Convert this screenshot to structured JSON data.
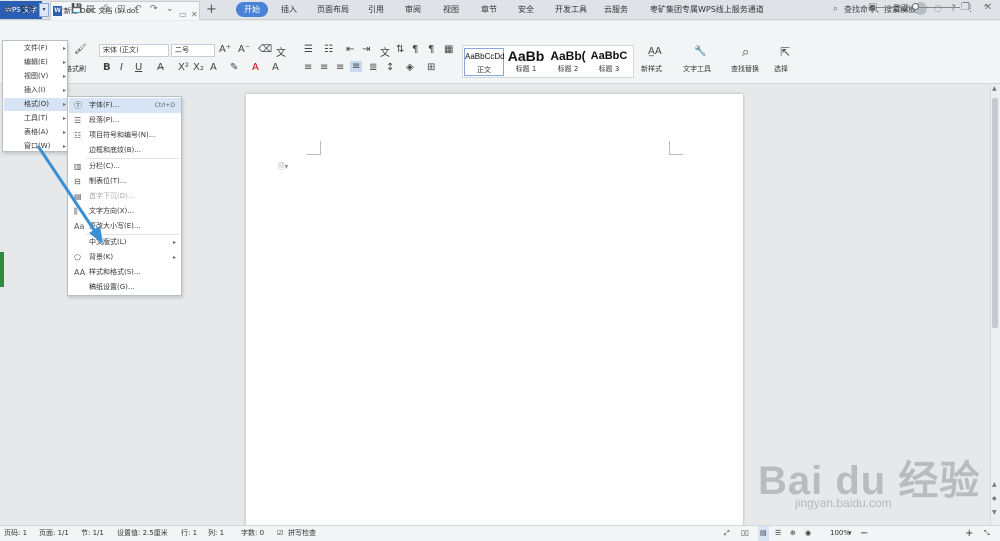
{
  "titlebar": {
    "app_tab": "WPS 文字",
    "doc_tab": "新建 DOC 文档 (5).doc",
    "login": "登录"
  },
  "menurow": {
    "file": "文件",
    "tabs": [
      "开始",
      "插入",
      "页面布局",
      "引用",
      "审阅",
      "视图",
      "章节",
      "安全",
      "开发工具",
      "云服务",
      "枣矿集团专属WPS线上服务通道"
    ],
    "search": "查找命令、搜索模板"
  },
  "ribbon": {
    "format_painter": "格式刷",
    "font_name": "宋体 (正文)",
    "font_size": "二号",
    "styles": [
      {
        "preview": "AaBbCcDd",
        "name": "正文"
      },
      {
        "preview": "AaBb",
        "name": "标题 1"
      },
      {
        "preview": "AaBb(",
        "name": "标题 2"
      },
      {
        "preview": "AaBbC",
        "name": "标题 3"
      }
    ],
    "new_style": "新样式",
    "text_tools": "文字工具",
    "find_replace": "查找替换",
    "select": "选择"
  },
  "file_menu": {
    "items": [
      {
        "label": "文件(F)"
      },
      {
        "label": "编辑(E)"
      },
      {
        "label": "视图(V)"
      },
      {
        "label": "插入(I)"
      },
      {
        "label": "格式(O)"
      },
      {
        "label": "工具(T)"
      },
      {
        "label": "表格(A)"
      },
      {
        "label": "窗口(W)"
      }
    ]
  },
  "format_menu": {
    "items": [
      {
        "label": "字体(F)...",
        "shortcut": "Ctrl+D"
      },
      {
        "label": "段落(P)..."
      },
      {
        "label": "项目符号和编号(N)..."
      },
      {
        "label": "边框和底纹(B)..."
      },
      {
        "label": "分栏(C)..."
      },
      {
        "label": "制表位(T)..."
      },
      {
        "label": "首字下沉(D)..."
      },
      {
        "label": "文字方向(X)..."
      },
      {
        "label": "更改大小写(E)..."
      },
      {
        "label": "中文版式(L)"
      },
      {
        "label": "背景(K)"
      },
      {
        "label": "样式和格式(S)..."
      },
      {
        "label": "稿纸设置(G)..."
      }
    ]
  },
  "status": {
    "page": "页码: 1",
    "pages": "页面: 1/1",
    "section": "节: 1/1",
    "setting": "设置值: 2.5厘米",
    "row": "行: 1",
    "col": "列: 1",
    "words": "字数: 0",
    "spell": "拼写检查",
    "zoom": "100%"
  },
  "watermark": {
    "main": "Bai du 经验",
    "sub": "jingyan.baidu.com"
  },
  "colors": {
    "accent": "#4a82d8",
    "app_blue": "#2b5fb3",
    "menu_highlight": "#d6e4f6",
    "arrow": "#3b8fd4"
  }
}
